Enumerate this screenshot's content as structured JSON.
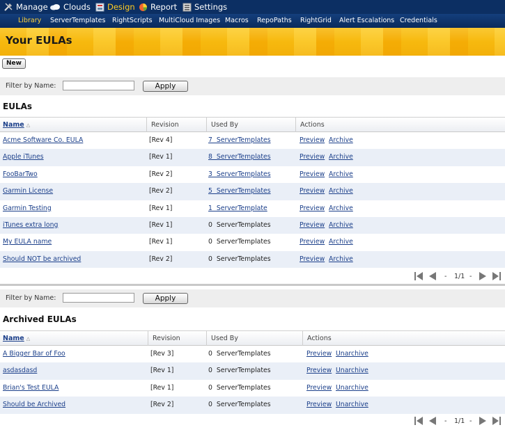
{
  "topnav": {
    "items": [
      {
        "label": "Manage",
        "icon": "tools-icon"
      },
      {
        "label": "Clouds",
        "icon": "cloud-icon"
      },
      {
        "label": "Design",
        "icon": "design-icon",
        "active": true
      },
      {
        "label": "Report",
        "icon": "pie-chart-icon"
      },
      {
        "label": "Settings",
        "icon": "settings-icon"
      }
    ]
  },
  "subnav": {
    "items": [
      "Library",
      "ServerTemplates",
      "RightScripts",
      "MultiCloud Images",
      "Macros",
      "RepoPaths",
      "RightGrid",
      "Alert Escalations",
      "Credentials"
    ],
    "active_index": 0
  },
  "banner": {
    "title": "Your EULAs"
  },
  "new_button": "New",
  "filter": {
    "label": "Filter by Name:",
    "value": "",
    "apply_label": "Apply"
  },
  "eulas": {
    "title": "EULAs",
    "columns": [
      "Name",
      "Revision",
      "Used By",
      "Actions"
    ],
    "rows": [
      {
        "name": "Acme Software Co. EULA",
        "revision": "[Rev 4]",
        "used_by": "7  ServerTemplates",
        "used_link": true,
        "actions": [
          "Preview",
          "Archive"
        ]
      },
      {
        "name": "Apple iTunes",
        "revision": "[Rev 1]",
        "used_by": "8  ServerTemplates",
        "used_link": true,
        "actions": [
          "Preview",
          "Archive"
        ]
      },
      {
        "name": "FooBarTwo",
        "revision": "[Rev 2]",
        "used_by": "3  ServerTemplates",
        "used_link": true,
        "actions": [
          "Preview",
          "Archive"
        ]
      },
      {
        "name": "Garmin License",
        "revision": "[Rev 2]",
        "used_by": "5  ServerTemplates",
        "used_link": true,
        "actions": [
          "Preview",
          "Archive"
        ]
      },
      {
        "name": "Garmin Testing",
        "revision": "[Rev 1]",
        "used_by": "1  ServerTemplate",
        "used_link": true,
        "actions": [
          "Preview",
          "Archive"
        ]
      },
      {
        "name": "iTunes extra long",
        "revision": "[Rev 1]",
        "used_by": "0  ServerTemplates",
        "used_link": false,
        "actions": [
          "Preview",
          "Archive"
        ]
      },
      {
        "name": "My EULA name",
        "revision": "[Rev 1]",
        "used_by": "0  ServerTemplates",
        "used_link": false,
        "actions": [
          "Preview",
          "Archive"
        ]
      },
      {
        "name": "Should NOT be archived",
        "revision": "[Rev 2]",
        "used_by": "0  ServerTemplates",
        "used_link": false,
        "actions": [
          "Preview",
          "Archive"
        ]
      }
    ],
    "pager": {
      "separator": "-",
      "page": "1/1"
    }
  },
  "archived": {
    "title": "Archived EULAs",
    "columns": [
      "Name",
      "Revision",
      "Used By",
      "Actions"
    ],
    "rows": [
      {
        "name": "A Bigger Bar of Foo",
        "revision": "[Rev 3]",
        "used_by": "0  ServerTemplates",
        "used_link": false,
        "actions": [
          "Preview",
          "Unarchive"
        ]
      },
      {
        "name": "asdasdasd",
        "revision": "[Rev 1]",
        "used_by": "0  ServerTemplates",
        "used_link": false,
        "actions": [
          "Preview",
          "Unarchive"
        ]
      },
      {
        "name": "Brian's Test EULA",
        "revision": "[Rev 1]",
        "used_by": "0  ServerTemplates",
        "used_link": false,
        "actions": [
          "Preview",
          "Unarchive"
        ]
      },
      {
        "name": "Should be Archived",
        "revision": "[Rev 2]",
        "used_by": "0  ServerTemplates",
        "used_link": false,
        "actions": [
          "Preview",
          "Unarchive"
        ]
      }
    ],
    "pager": {
      "separator": "-",
      "page": "1/1"
    }
  }
}
